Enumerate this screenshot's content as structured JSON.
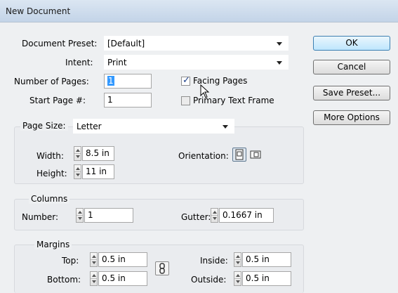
{
  "window": {
    "title": "New Document"
  },
  "preset": {
    "label": "Document Preset:",
    "value": "[Default]"
  },
  "intent": {
    "label": "Intent:",
    "value": "Print"
  },
  "pages": {
    "label": "Number of Pages:",
    "value": "1"
  },
  "start_page": {
    "label": "Start Page #:",
    "value": "1"
  },
  "facing_pages": {
    "label": "Facing Pages",
    "checked": true
  },
  "primary_text_frame": {
    "label": "Primary Text Frame",
    "checked": false
  },
  "page_size": {
    "label": "Page Size:",
    "value": "Letter"
  },
  "width": {
    "label": "Width:",
    "value": "8.5 in"
  },
  "height": {
    "label": "Height:",
    "value": "11 in"
  },
  "orientation": {
    "label": "Orientation:"
  },
  "columns": {
    "title": "Columns",
    "number_label": "Number:",
    "number_value": "1",
    "gutter_label": "Gutter:",
    "gutter_value": "0.1667 in"
  },
  "margins": {
    "title": "Margins",
    "top_label": "Top:",
    "top_value": "0.5 in",
    "bottom_label": "Bottom:",
    "bottom_value": "0.5 in",
    "inside_label": "Inside:",
    "inside_value": "0.5 in",
    "outside_label": "Outside:",
    "outside_value": "0.5 in"
  },
  "buttons": {
    "ok": "OK",
    "cancel": "Cancel",
    "save_preset": "Save Preset...",
    "more_options": "More Options"
  }
}
